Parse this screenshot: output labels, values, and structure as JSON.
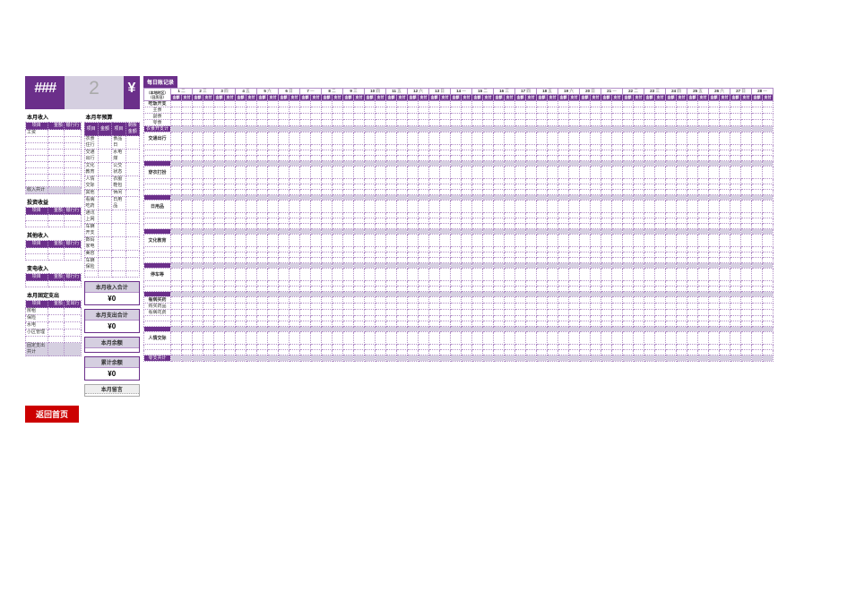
{
  "header": {
    "year": "###",
    "month": "2",
    "currency": "¥"
  },
  "income": {
    "title": "本月收入",
    "cols": [
      "项目",
      "金额",
      "银行行"
    ],
    "rows": [
      "工资",
      "",
      "",
      "",
      "",
      "",
      "",
      "",
      ""
    ],
    "sum_label": "收入共计"
  },
  "prepay": {
    "title": "本月年预算",
    "cols": [
      "项目",
      "金额",
      "项目",
      "剩余金额"
    ],
    "rows": [
      [
        "衣食住行",
        "",
        "食品日",
        ""
      ],
      [
        "交通出行",
        "",
        "水电煤",
        ""
      ],
      [
        "文化教育",
        "",
        "公交状态",
        ""
      ],
      [
        "人情交际",
        "",
        "衣服鞋包",
        ""
      ],
      [
        "其他",
        "",
        "休闲",
        ""
      ],
      [
        "看病吃药",
        "",
        "日用品",
        ""
      ],
      [
        "通讯上网",
        "",
        "",
        ""
      ],
      [
        "车辆开支",
        "",
        "",
        ""
      ],
      [
        "数码家电",
        "",
        "",
        ""
      ],
      [
        "美容",
        "",
        "",
        ""
      ],
      [
        "车辆保险",
        "",
        "",
        ""
      ],
      [
        "",
        "",
        "",
        ""
      ]
    ]
  },
  "invest": {
    "title": "投资收益",
    "cols": [
      "项目",
      "金额",
      "银行行"
    ],
    "rows": [
      "",
      ""
    ]
  },
  "other_income": {
    "title": "其他收入",
    "cols": [
      "项目",
      "金额",
      "银行行"
    ],
    "rows": [
      "",
      ""
    ]
  },
  "variable_income": {
    "title": "变电收入",
    "cols": [
      "项目",
      "金额",
      "银行行"
    ],
    "rows": [
      ""
    ]
  },
  "fixed_expense": {
    "title": "本月固定支出",
    "cols": [
      "项目",
      "金额",
      "支出行"
    ],
    "rows": [
      "房租",
      "保险",
      "水电",
      "小区管理",
      ""
    ],
    "sum_label": "固定支出共计"
  },
  "summaries": {
    "income_total": {
      "label": "本月收入合计",
      "value": "¥0"
    },
    "expense_total": {
      "label": "本月支出合计",
      "value": "¥0"
    },
    "month_balance": {
      "label": "本月余额",
      "value": ""
    },
    "cumulative": {
      "label": "累计余额",
      "value": "¥0"
    }
  },
  "memo_label": "本月留言",
  "return_label": "返回首页",
  "daily": {
    "title": "每日账记录",
    "weekday_label_a": "（本地时区）",
    "weekday_label_b": "（日历日）",
    "sub_headers": [
      "金额",
      "支付"
    ],
    "days": [
      1,
      2,
      3,
      4,
      5,
      6,
      7,
      8,
      9,
      10,
      11,
      12,
      13,
      14,
      15,
      16,
      17,
      18,
      19,
      20,
      21,
      22,
      23,
      24,
      25,
      26,
      27,
      28
    ],
    "dows": [
      "二",
      "三",
      "四",
      "五",
      "六",
      "日",
      "一",
      "二",
      "三",
      "四",
      "五",
      "六",
      "日",
      "一",
      "二",
      "三",
      "四",
      "五",
      "六",
      "日",
      "一",
      "二",
      "三",
      "四",
      "五",
      "六",
      "日",
      "一"
    ],
    "sections": [
      {
        "name": "吃饭开支",
        "rows": [
          "主食",
          "副食",
          "零食"
        ],
        "subtotal": "衣食开支计"
      },
      {
        "name": "交通出行",
        "rows": [
          "",
          "",
          "",
          ""
        ],
        "subtotal": ""
      },
      {
        "name": "穿衣打扮",
        "rows": [
          "",
          "",
          "",
          ""
        ],
        "subtotal": ""
      },
      {
        "name": "日用品",
        "rows": [
          "",
          "",
          "",
          ""
        ],
        "subtotal": ""
      },
      {
        "name": "文化教育",
        "rows": [
          "",
          "",
          "",
          ""
        ],
        "subtotal": ""
      },
      {
        "name": "停车等",
        "rows": [
          "",
          "",
          ""
        ],
        "subtotal": ""
      },
      {
        "name": "看病买药",
        "rows": [
          "购买药品",
          "看病花费",
          "",
          ""
        ],
        "subtotal": ""
      },
      {
        "name": "人情交际",
        "rows": [
          "",
          "",
          ""
        ],
        "subtotal": "零支共计"
      }
    ]
  }
}
